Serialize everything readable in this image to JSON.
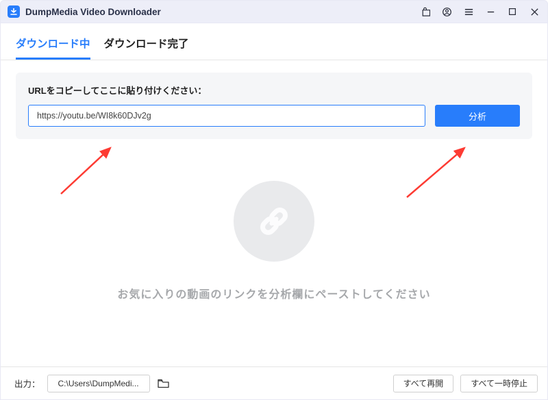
{
  "titlebar": {
    "app_name": "DumpMedia Video Downloader"
  },
  "tabs": {
    "downloading": "ダウンロード中",
    "downloaded": "ダウンロード完了"
  },
  "url_panel": {
    "label": "URLをコピーしてここに貼り付けください：",
    "input_value": "https://youtu.be/WI8k60DJv2g",
    "analyze_label": "分析"
  },
  "empty": {
    "message": "お気に入りの動画のリンクを分析欄にペーストしてください"
  },
  "footer": {
    "output_label": "出力：",
    "output_path": "C:\\Users\\DumpMedi...",
    "resume_all": "すべて再開",
    "pause_all": "すべて一時停止"
  }
}
